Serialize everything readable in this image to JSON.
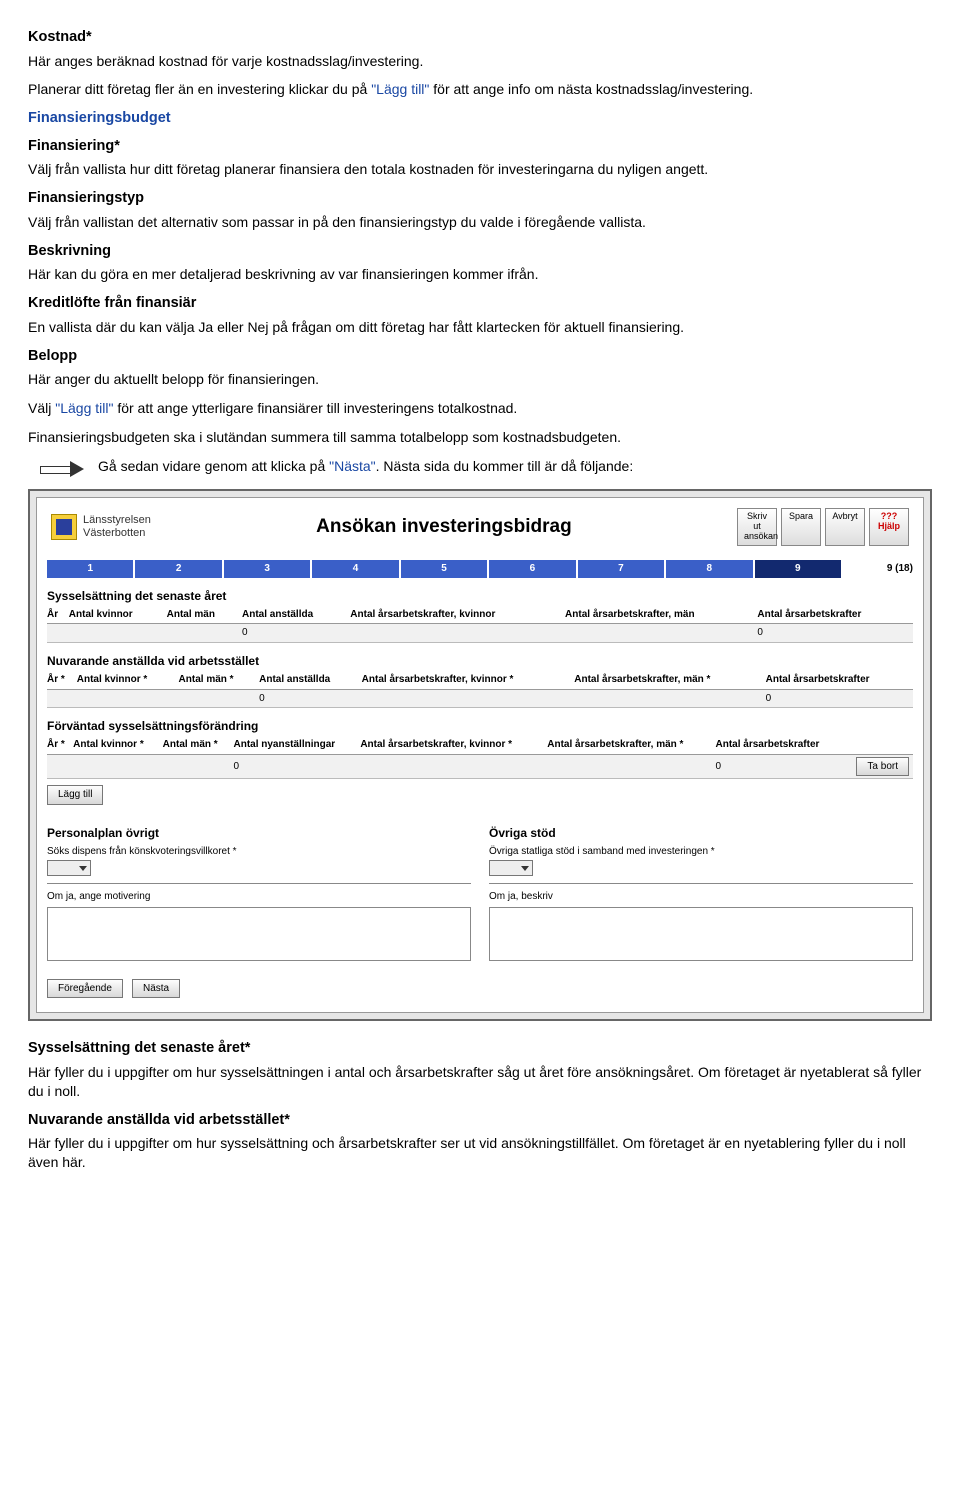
{
  "doc": {
    "kostnad": {
      "heading": "Kostnad*",
      "p": "Här anges beräknad kostnad för varje kostnadsslag/investering."
    },
    "planerar": {
      "pre": "Planerar ditt företag fler än en investering klickar du på ",
      "link": "\"Lägg till\"",
      "post": " för att ange info om nästa kostnadsslag/investering."
    },
    "finbudget": {
      "heading": "Finansieringsbudget"
    },
    "finansiering": {
      "heading": "Finansiering*",
      "p": "Välj från vallista hur ditt företag planerar finansiera den totala kostnaden för investeringarna du nyligen angett."
    },
    "fintyp": {
      "heading": "Finansieringstyp",
      "p": "Välj från vallistan det alternativ som passar in på den finansieringstyp du valde i föregående vallista."
    },
    "beskriv": {
      "heading": "Beskrivning",
      "p": "Här kan du göra en mer detaljerad beskrivning av var finansieringen kommer ifrån."
    },
    "kredit": {
      "heading": "Kreditlöfte från finansiär",
      "p": "En vallista där du kan välja Ja eller Nej på frågan om ditt företag har fått klartecken för aktuell finansiering."
    },
    "belopp": {
      "heading": "Belopp",
      "p": "Här anger du aktuellt belopp för finansieringen."
    },
    "valj": {
      "pre": "Välj ",
      "link": "\"Lägg till\"",
      "post": " för att ange ytterligare finansiärer till investeringens totalkostnad."
    },
    "summera": "Finansieringsbudgeten ska i slutändan summera till samma totalbelopp som kostnadsbudgeten.",
    "ga": {
      "pre": "Gå sedan vidare genom att klicka på ",
      "link": "\"Nästa\"",
      "post": ". Nästa sida du kommer till är då följande:"
    },
    "syssel": {
      "heading": "Sysselsättning det senaste året*",
      "p": "Här fyller du i uppgifter om hur sysselsättningen i antal och årsarbetskrafter såg ut året före ansökningsåret. Om företaget är nyetablerat så fyller du i noll."
    },
    "nuv": {
      "heading": "Nuvarande anställda vid arbetsstället*",
      "p": "Här fyller du i uppgifter om hur sysselsättning och årsarbetskrafter ser ut vid ansökningstillfället. Om företaget är en nyetablering fyller du i noll även här."
    }
  },
  "app": {
    "brand1": "Länsstyrelsen",
    "brand2": "Västerbotten",
    "title": "Ansökan investeringsbidrag",
    "buttons": {
      "print": "Skriv ut ansökan",
      "save": "Spara",
      "cancel": "Avbryt",
      "help": "??? Hjälp"
    },
    "steps": [
      "1",
      "2",
      "3",
      "4",
      "5",
      "6",
      "7",
      "8",
      "9"
    ],
    "stepCount": "9 (18)",
    "section1": {
      "title": "Sysselsättning det senaste året",
      "cols": [
        "År",
        "Antal kvinnor",
        "Antal män",
        "Antal anställda",
        "Antal årsarbetskrafter, kvinnor",
        "Antal årsarbetskrafter, män",
        "Antal årsarbetskrafter"
      ],
      "zero": "0"
    },
    "section2": {
      "title": "Nuvarande anställda vid arbetsstället",
      "cols": [
        "År *",
        "Antal kvinnor *",
        "Antal män *",
        "Antal anställda",
        "Antal årsarbetskrafter, kvinnor *",
        "Antal årsarbetskrafter, män *",
        "Antal årsarbetskrafter"
      ],
      "zero": "0"
    },
    "section3": {
      "title": "Förväntad sysselsättningsförändring",
      "cols": [
        "År *",
        "Antal kvinnor *",
        "Antal män *",
        "Antal nyanställningar",
        "Antal årsarbetskrafter, kvinnor *",
        "Antal årsarbetskrafter, män *",
        "Antal årsarbetskrafter"
      ],
      "zero": "0",
      "tabort": "Ta bort",
      "lagg": "Lägg till"
    },
    "section4": {
      "left": {
        "title": "Personalplan övrigt",
        "q1": "Söks dispens från könskvoteringsvillkoret *",
        "q2": "Om ja, ange motivering"
      },
      "right": {
        "title": "Övriga stöd",
        "q1": "Övriga statliga stöd i samband med investeringen *",
        "q2": "Om ja, beskriv"
      }
    },
    "nav": {
      "prev": "Föregående",
      "next": "Nästa"
    }
  }
}
